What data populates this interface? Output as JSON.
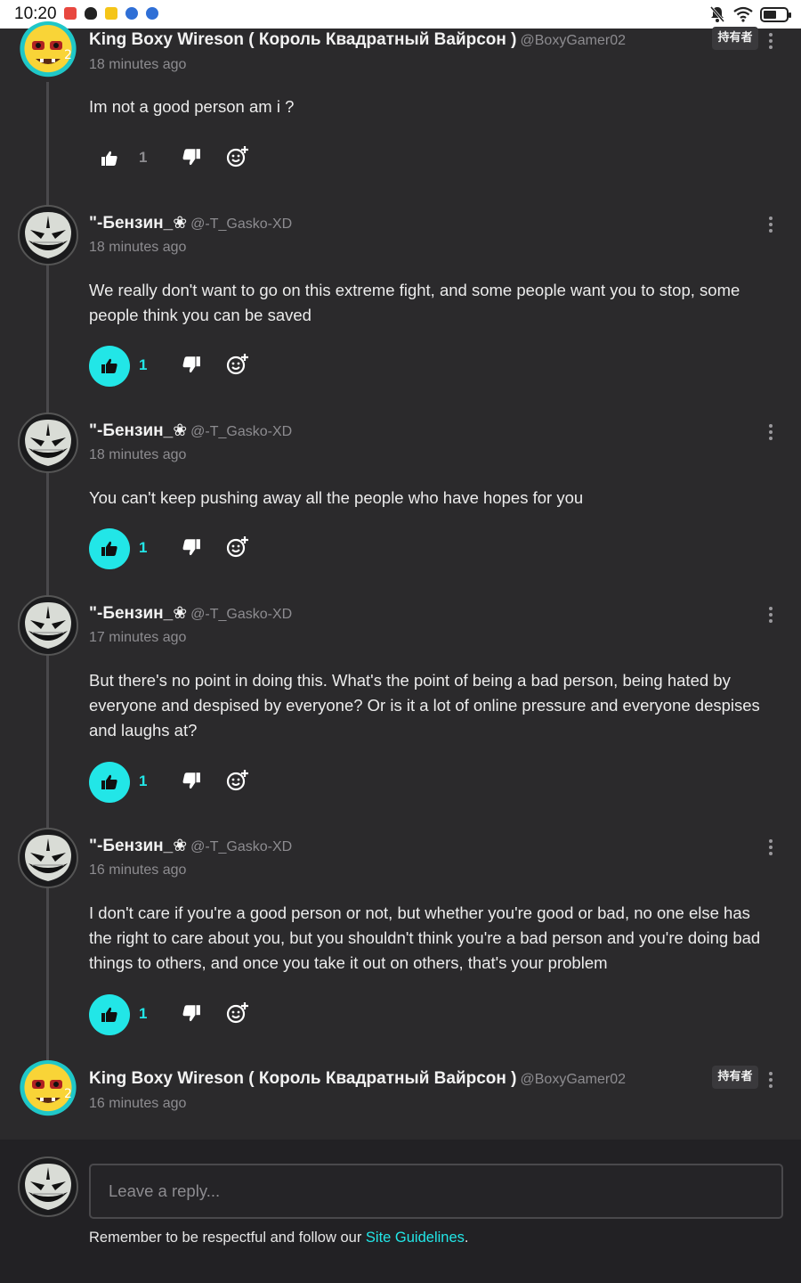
{
  "status_bar": {
    "time": "10:20",
    "battery_level": 0.6
  },
  "comments": [
    {
      "author": "King Boxy Wireson ( Король Квадратный Вайрсон )",
      "handle": "@BoxyGamer02",
      "time": "18 minutes ago",
      "owner_tag": "持有者",
      "text": "Im not a good person am i ?",
      "likes": "1",
      "liked": false,
      "avatar_icon": "boxy-avatar"
    },
    {
      "author": "\"-Бензин_❀",
      "handle": "@-T_Gasko-XD",
      "time": "18 minutes ago",
      "text": "We really don't want to go on this extreme fight, and some people want you to stop, some people think you can be saved",
      "likes": "1",
      "liked": true,
      "avatar_icon": "grin-mask-avatar"
    },
    {
      "author": "\"-Бензин_❀",
      "handle": "@-T_Gasko-XD",
      "time": "18 minutes ago",
      "text": "You can't keep pushing away all the people who have hopes for you",
      "likes": "1",
      "liked": true,
      "avatar_icon": "grin-mask-avatar"
    },
    {
      "author": "\"-Бензин_❀",
      "handle": "@-T_Gasko-XD",
      "time": "17 minutes ago",
      "text": "But there's no point in doing this. What's the point of being a bad person, being hated by everyone and despised by everyone? Or is it a lot of online pressure and everyone despises and laughs at?",
      "likes": "1",
      "liked": true,
      "avatar_icon": "grin-mask-avatar"
    },
    {
      "author": "\"-Бензин_❀",
      "handle": "@-T_Gasko-XD",
      "time": "16 minutes ago",
      "text": "I don't care if you're a good person or not, but whether you're good or bad, no one else has the right to care about you, but you shouldn't think you're a bad person and you're doing bad things to others, and once you take it out on others, that's your problem",
      "likes": "1",
      "liked": true,
      "avatar_icon": "grin-mask-avatar"
    },
    {
      "author": "King Boxy Wireson ( Король Квадратный Вайрсон )",
      "handle": "@BoxyGamer02",
      "time": "16 minutes ago",
      "owner_tag": "持有者",
      "avatar_icon": "boxy-avatar"
    }
  ],
  "reply": {
    "placeholder": "Leave a reply...",
    "notice": "Remember to be respectful and follow our ",
    "link": "Site Guidelines",
    "notice_end": "."
  },
  "colors": {
    "accent": "#22e6e7",
    "background": "#2b2a2c",
    "muted": "#8d8c90"
  }
}
